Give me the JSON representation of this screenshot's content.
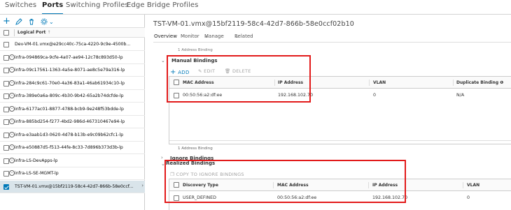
{
  "tabs": [
    "Switches",
    "Ports",
    "Switching Profiles",
    "Edge Bridge Profiles"
  ],
  "left_toolbar": {
    "add_icon": "plus-icon",
    "edit_icon": "pencil-icon",
    "delete_icon": "trash-icon",
    "settings_icon": "gear-icon",
    "settings_chevron": "⌄"
  },
  "port_list": {
    "header": "Logical Port",
    "sort_glyph": "↑",
    "items": [
      "Dev-VM-01.vmx@e29cc40c-75ca-4220-9c9e-4500b...",
      "infra-094869ca-9cfe-4a07-ae94-12c78c893d50-lp",
      "infra-09c17561-1363-4a5e-8071-ae8c5e79a316-lp",
      "infra-284c9c61-70e0-4a36-83a1-46ab61934c10-lp",
      "infra-389e0a6a-809c-4b30-9b42-65a2b74dcfde-lp",
      "infra-6177ac01-8877-4788-bcb9-9e248f53bdde-lp",
      "infra-885bd254-f277-4bd2-986d-467310467e94-lp",
      "infra-e3aab1d3-0620-4d78-b13b-e9c09b62cfc1-lp",
      "infra-e50887d5-f513-44fe-8c33-7d896b373d3b-lp",
      "infra-LS-DevApps-lp",
      "infra-LS-SE-MGMT-lp",
      "TST-VM-01.vmx@15bf2119-58c4-42d7-866b-58e0ccf..."
    ],
    "selected_index": 11
  },
  "detail": {
    "title": "TST-VM-01.vmx@15bf2119-58c4-42d7-866b-58e0ccf02b10",
    "subnav": [
      "Overview",
      "Monitor",
      "Manage",
      "Related"
    ],
    "cut_off_text": "1 Address Binding",
    "manual_bindings": {
      "heading": "Manual Bindings",
      "actions": {
        "add": "ADD",
        "edit": "EDIT",
        "delete": "DELETE"
      },
      "columns": [
        "MAC Address",
        "IP Address",
        "VLAN",
        "Duplicate Binding"
      ],
      "row": {
        "mac": "00:50:56:a2:df:ee",
        "ip": "192.168.102.70",
        "vlan": "0",
        "duplicate": "N/A"
      },
      "footer": "1 Address Binding"
    },
    "ignore_bindings": {
      "heading": "Ignore Bindings"
    },
    "realized_bindings": {
      "heading": "Realized Bindings",
      "action": "COPY TO IGNORE BINDINGS",
      "columns": [
        "Discovery Type",
        "MAC Address",
        "IP Address",
        "VLAN"
      ],
      "row": {
        "type": "USER_DEFINED",
        "mac": "00:50:56:a2:df:ee",
        "ip": "192.168.102.70",
        "vlan": "0"
      }
    }
  },
  "colors": {
    "accent": "#0079b8",
    "highlight": "#e21a1a",
    "selected_row": "#d9e4ea"
  }
}
